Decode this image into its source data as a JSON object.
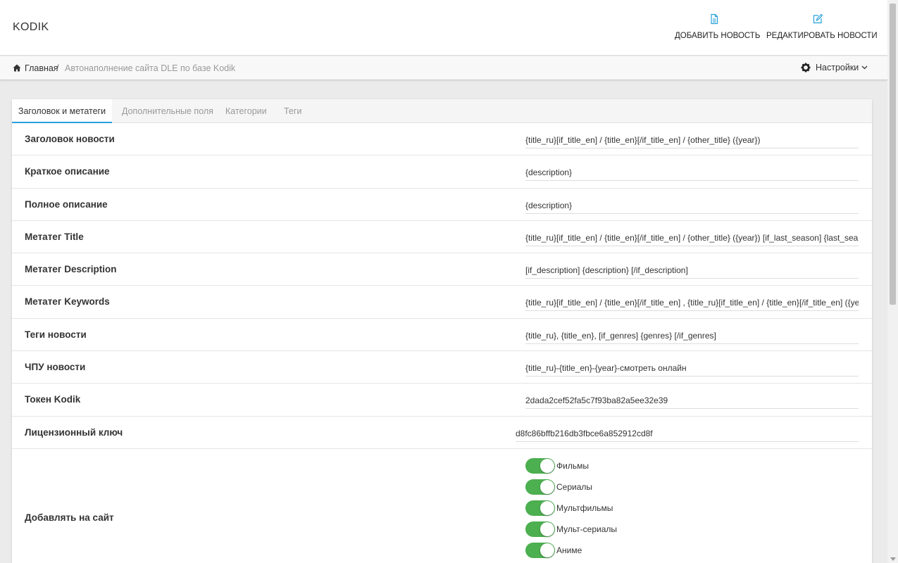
{
  "header": {
    "brand": "KODIK",
    "add_news": "ДОБАВИТЬ НОВОСТЬ",
    "edit_news": "РЕДАКТИРОВАТЬ НОВОСТИ"
  },
  "breadcrumb": {
    "home": "Главная",
    "separator": "/",
    "current": "Автонаполнение сайта DLE по базе Kodik",
    "settings": "Настройки"
  },
  "tabs": [
    "Заголовок и метатеги",
    "Дополнительные поля",
    "Категории",
    "Теги"
  ],
  "fields": [
    {
      "label": "Заголовок новости",
      "value": "{title_ru}[if_title_en] / {title_en}[/if_title_en] / {other_title} ({year})"
    },
    {
      "label": "Краткое описание",
      "value": "{description}"
    },
    {
      "label": "Полное описание",
      "value": "{description}"
    },
    {
      "label": "Метатег Title",
      "value": "{title_ru}[if_title_en] / {title_en}[/if_title_en] / {other_title} ({year}) [if_last_season] {last_season} се"
    },
    {
      "label": "Метатег Description",
      "value": "[if_description] {description} [/if_description]"
    },
    {
      "label": "Метатег Keywords",
      "value": "{title_ru}[if_title_en] / {title_en}[/if_title_en] , {title_ru}[if_title_en] / {title_en}[/if_title_en] ({year}) ,"
    },
    {
      "label": "Теги новости",
      "value": "{title_ru}, {title_en}, [if_genres] {genres} [/if_genres]"
    },
    {
      "label": "ЧПУ новости",
      "value": "{title_ru}-{title_en}-{year}-смотреть онлайн"
    },
    {
      "label": "Токен Kodik",
      "value": "2dada2cef52fa5c7f93ba82a5ee32e39"
    },
    {
      "label": "Лицензионный ключ",
      "value": "d8fc86bffb216db3fbce6a852912cd8f"
    }
  ],
  "add_to_site": {
    "label": "Добавлять на сайт",
    "options": [
      {
        "label": "Фильмы",
        "enabled": true
      },
      {
        "label": "Сериалы",
        "enabled": true
      },
      {
        "label": "Мультфильмы",
        "enabled": true
      },
      {
        "label": "Мульт-сериалы",
        "enabled": true
      },
      {
        "label": "Аниме",
        "enabled": true
      }
    ]
  },
  "colors": {
    "accent": "#26a0da",
    "toggle_on": "#4caf50"
  }
}
